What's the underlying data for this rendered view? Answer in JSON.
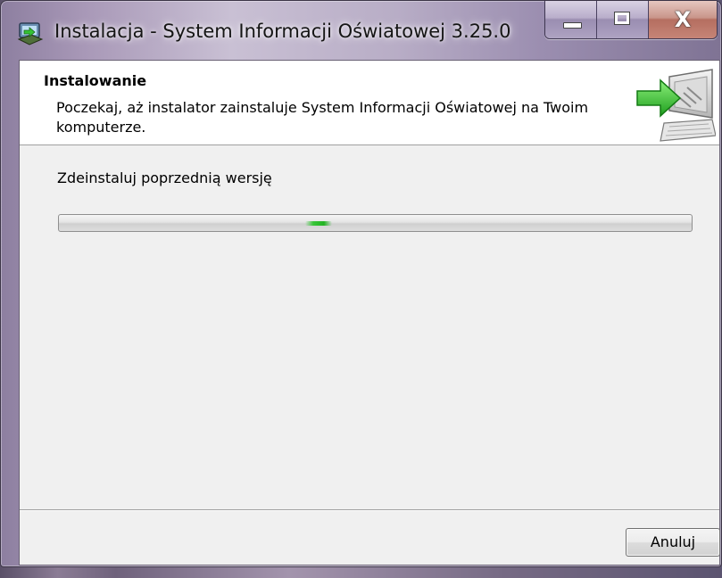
{
  "window": {
    "title": "Instalacja - System Informacji Oświatowej 3.25.0",
    "app_icon": "installer-app-icon",
    "close_glyph": "X"
  },
  "header": {
    "title": "Instalowanie",
    "subtitle": "Poczekaj, aż instalator zainstaluje System Informacji Oświatowej na Twoim komputerze.",
    "icon": "computer-install-arrow-icon"
  },
  "main": {
    "status_text": "Zdeinstaluj poprzednią wersję",
    "progress": {
      "mode": "marquee",
      "indicator_position_fraction": 0.41,
      "accent_color": "#2fbf2f"
    }
  },
  "footer": {
    "cancel_label": "Anuluj"
  }
}
